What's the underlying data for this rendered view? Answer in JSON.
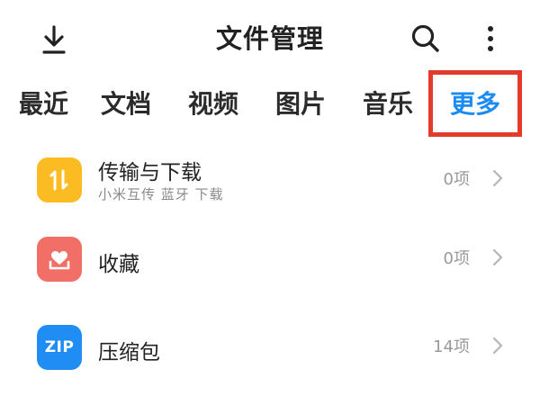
{
  "header": {
    "title": "文件管理",
    "download_icon": "download-icon",
    "search_icon": "search-icon",
    "more_icon": "more-vertical-icon"
  },
  "tabs": [
    {
      "label": "最近",
      "visible_partial": true
    },
    {
      "label": "文档"
    },
    {
      "label": "视频"
    },
    {
      "label": "图片"
    },
    {
      "label": "音乐"
    },
    {
      "label": "更多",
      "selected": true
    }
  ],
  "colors": {
    "accent": "#1d8cf2",
    "highlight_box": "#e23b2d",
    "transfer_icon_bg": "#fbbb22",
    "favorites_icon_bg": "#f26f68",
    "zip_icon_bg": "#1f8df3"
  },
  "list": {
    "items": [
      {
        "label": "传输与下载",
        "subtitle": "小米互传 蓝牙 下载",
        "count": "0项",
        "icon": "transfer-icon"
      },
      {
        "label": "收藏",
        "count": "0项",
        "icon": "favorites-icon"
      },
      {
        "label": "压缩包",
        "count": "14项",
        "icon": "zip-icon",
        "icon_text": "ZIP"
      }
    ]
  }
}
